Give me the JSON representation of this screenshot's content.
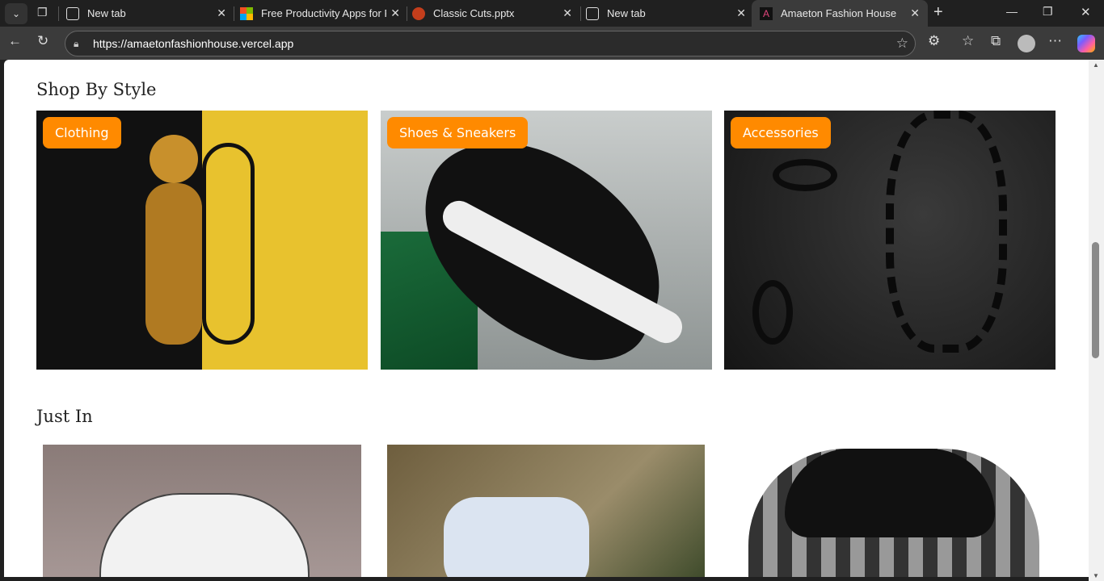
{
  "browser": {
    "tabs": [
      {
        "title": "New tab",
        "icon": "newtab-icon"
      },
      {
        "title": "Free Productivity Apps for Pe",
        "icon": "microsoft-icon"
      },
      {
        "title": "Classic Cuts.pptx",
        "icon": "powerpoint-icon"
      },
      {
        "title": "New tab",
        "icon": "newtab-icon"
      },
      {
        "title": "Amaeton Fashion House",
        "icon": "site-logo-icon",
        "active": true
      }
    ],
    "url": "https://amaetonfashionhouse.vercel.app"
  },
  "shop_by_style": {
    "heading": "Shop By Style",
    "categories": [
      {
        "label": "Clothing"
      },
      {
        "label": "Shoes & Sneakers"
      },
      {
        "label": "Accessories"
      }
    ]
  },
  "just_in": {
    "heading": "Just In"
  },
  "colors": {
    "accent": "#ff8a00"
  }
}
